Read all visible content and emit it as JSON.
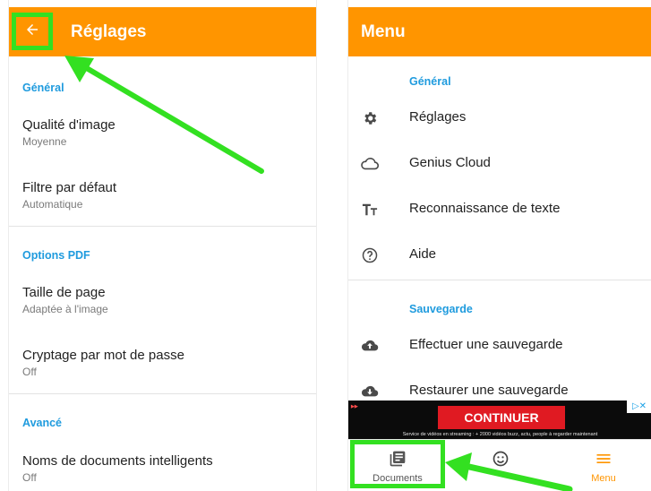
{
  "left": {
    "title": "Réglages",
    "sections": [
      {
        "label": "Général"
      },
      {
        "label": "Options PDF"
      },
      {
        "label": "Avancé"
      }
    ],
    "prefs": [
      {
        "title": "Qualité d'image",
        "value": "Moyenne"
      },
      {
        "title": "Filtre par défaut",
        "value": "Automatique"
      },
      {
        "title": "Taille de page",
        "value": "Adaptée à l'image"
      },
      {
        "title": "Cryptage par mot de passe",
        "value": "Off"
      },
      {
        "title": "Noms de documents intelligents",
        "value": "Off"
      }
    ]
  },
  "right": {
    "title": "Menu",
    "sections": [
      {
        "label": "Général"
      },
      {
        "label": "Sauvegarde"
      }
    ],
    "items": [
      {
        "label": "Réglages",
        "icon": "gear-icon"
      },
      {
        "label": "Genius Cloud",
        "icon": "cloud-icon"
      },
      {
        "label": "Reconnaissance de texte",
        "icon": "text-recognition-icon"
      },
      {
        "label": "Aide",
        "icon": "help-icon"
      },
      {
        "label": "Effectuer une sauvegarde",
        "icon": "cloud-upload-icon"
      },
      {
        "label": "Restaurer une sauvegarde",
        "icon": "cloud-download-icon"
      }
    ],
    "ad": {
      "button": "CONTINUER",
      "fineprint": "Service de vidéos en streaming : + 2000 vidéos buzz, actu, people à regarder maintenant"
    },
    "bottom_nav": [
      {
        "label": "Documents",
        "icon": "documents-icon"
      },
      {
        "label": "",
        "icon": "smiley-icon"
      },
      {
        "label": "Menu",
        "icon": "hamburger-icon"
      }
    ]
  },
  "colors": {
    "accent": "#FF9500",
    "highlight": "#33E021",
    "section_label": "#1F9BDE"
  }
}
